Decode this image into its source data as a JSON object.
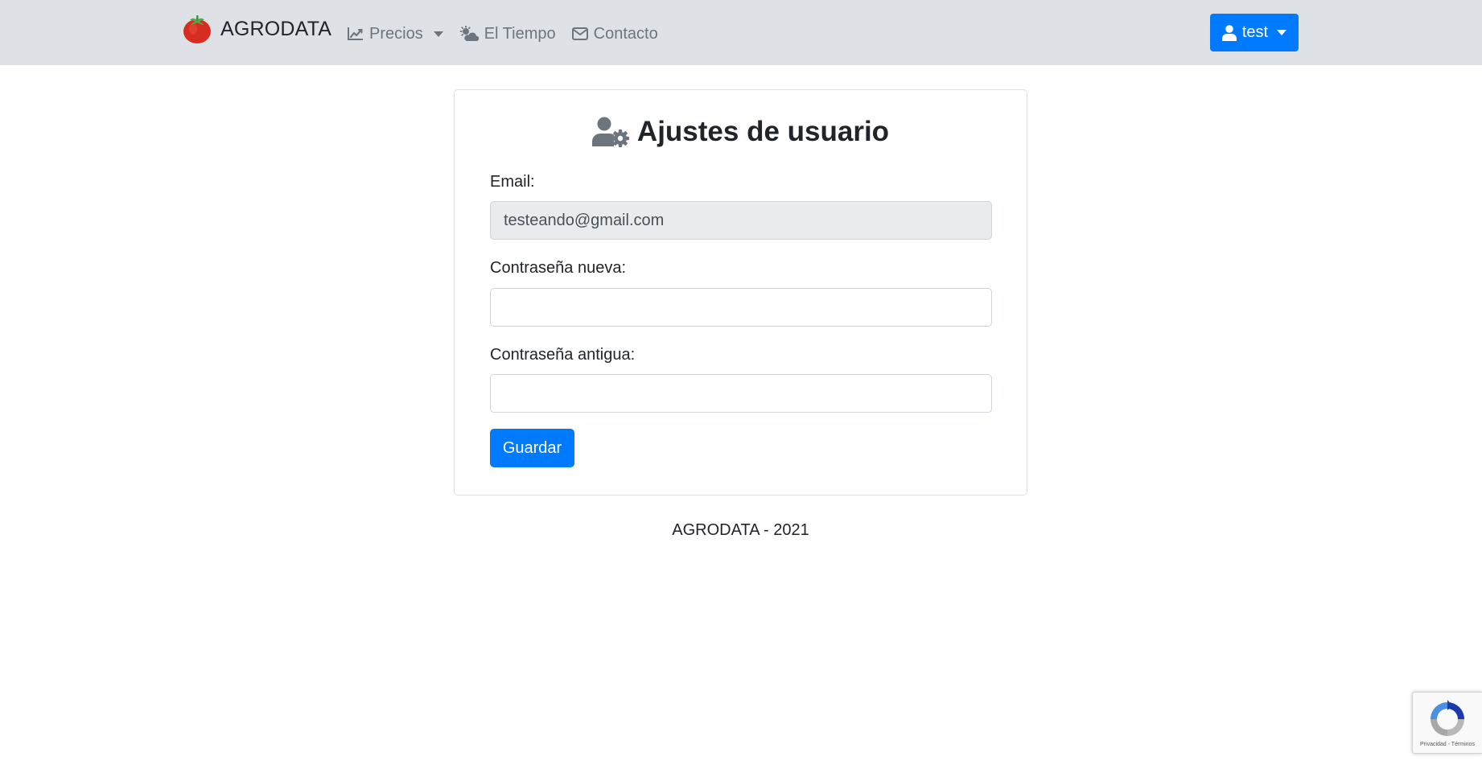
{
  "navbar": {
    "brand": "AGRODATA",
    "links": [
      {
        "label": "Precios",
        "icon": "chart-line-icon",
        "dropdown": true
      },
      {
        "label": "El Tiempo",
        "icon": "cloud-sun-icon",
        "dropdown": false
      },
      {
        "label": "Contacto",
        "icon": "envelope-icon",
        "dropdown": false
      }
    ],
    "user_menu": {
      "label": "test",
      "icon": "user-icon"
    }
  },
  "settings_card": {
    "title": "Ajustes de usuario",
    "title_icon": "user-cog-icon",
    "email": {
      "label": "Email:",
      "value": "testeando@gmail.com"
    },
    "new_password": {
      "label": "Contraseña nueva:",
      "value": ""
    },
    "old_password": {
      "label": "Contraseña antigua:",
      "value": ""
    },
    "save_label": "Guardar"
  },
  "footer": {
    "text": "AGRODATA - 2021"
  },
  "recaptcha": {
    "text": "Privacidad - Términos"
  },
  "colors": {
    "navbar_bg": "#dee2e6",
    "primary": "#007bff",
    "muted_text": "#6c757d",
    "readonly_input_bg": "#e9ecef"
  }
}
